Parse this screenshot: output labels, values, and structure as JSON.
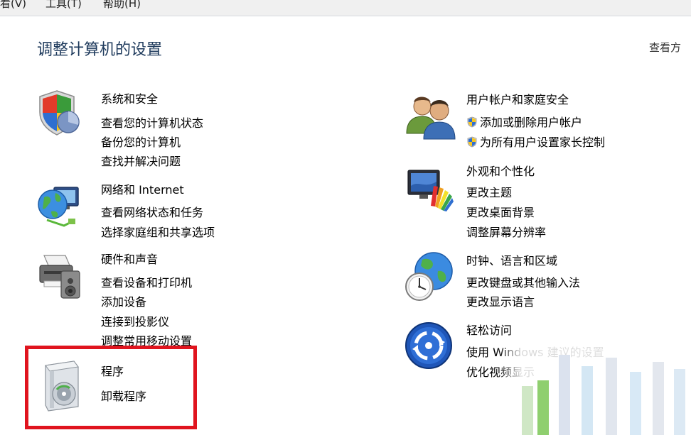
{
  "menubar": {
    "view": "看(V)",
    "tools": "工具(T)",
    "help": "帮助(H)"
  },
  "page_title": "调整计算机的设置",
  "view_by": "查看方",
  "categories": [
    {
      "title": "系统和安全",
      "icon": "shield-icon",
      "links": [
        "查看您的计算机状态",
        "备份您的计算机",
        "查找并解决问题"
      ]
    },
    {
      "title": "网络和 Internet",
      "icon": "network-globe-icon",
      "links": [
        "查看网络状态和任务",
        "选择家庭组和共享选项"
      ]
    },
    {
      "title": "硬件和声音",
      "icon": "printer-speaker-icon",
      "links": [
        "查看设备和打印机",
        "添加设备",
        "连接到投影仪",
        "调整常用移动设置"
      ]
    },
    {
      "title": "程序",
      "icon": "program-box-icon",
      "links": [
        "卸载程序"
      ]
    },
    {
      "title": "用户帐户和家庭安全",
      "icon": "users-icon",
      "links": [
        "添加或删除用户帐户",
        "为所有用户设置家长控制"
      ]
    },
    {
      "title": "外观和个性化",
      "icon": "monitor-palette-icon",
      "links": [
        "更改主题",
        "更改桌面背景",
        "调整屏幕分辨率"
      ]
    },
    {
      "title": "时钟、语言和区域",
      "icon": "globe-clock-icon",
      "links": [
        "更改键盘或其他输入法",
        "更改显示语言"
      ]
    },
    {
      "title": "轻松访问",
      "icon": "ease-of-access-icon",
      "links": [
        "使用 Windows 建议的设置",
        "优化视频显示"
      ]
    }
  ],
  "colors": {
    "title_green": "#1f7a22",
    "link_blue": "#1a52a8",
    "highlight_red": "#e0141e"
  }
}
